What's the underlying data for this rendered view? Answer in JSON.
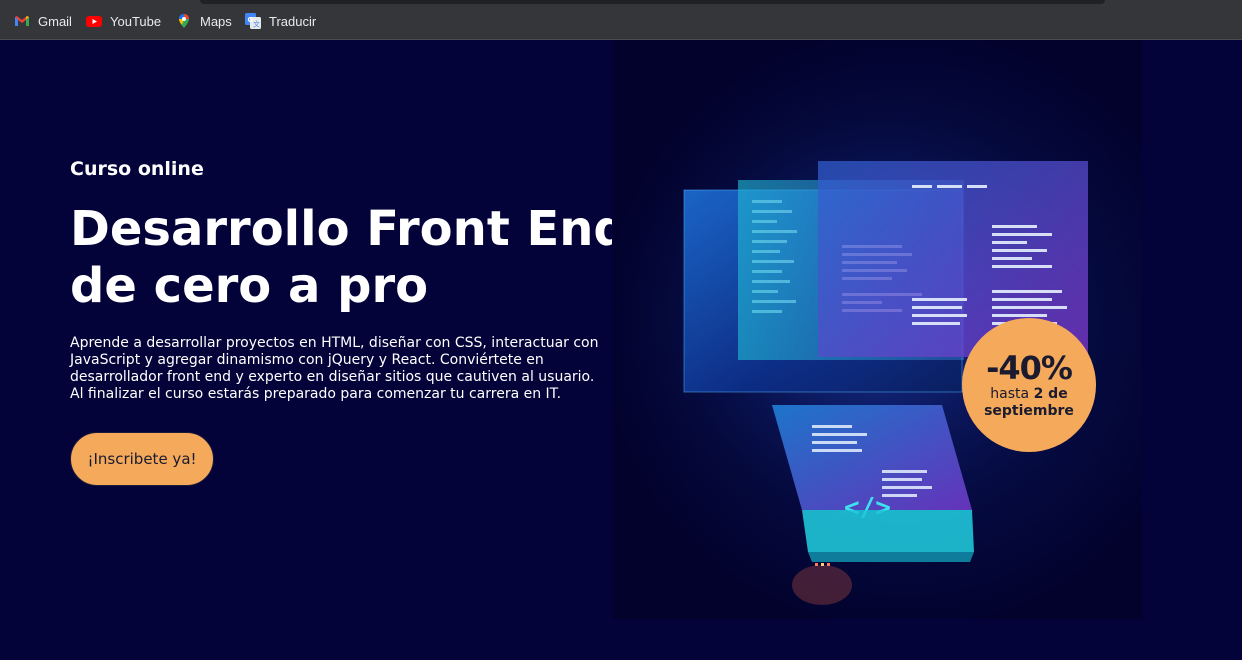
{
  "bookmarks": [
    {
      "label": "Gmail",
      "icon": "gmail-icon"
    },
    {
      "label": "YouTube",
      "icon": "youtube-icon"
    },
    {
      "label": "Maps",
      "icon": "maps-icon"
    },
    {
      "label": "Traducir",
      "icon": "translate-icon"
    }
  ],
  "hero": {
    "eyebrow": "Curso online",
    "title_line1": "Desarrollo Front End",
    "title_line2": "de cero a pro",
    "description": "Aprende a desarrollar proyectos en HTML, diseñar con CSS, interactuar con JavaScript y agregar dinamismo con jQuery y React. Conviértete en desarrollador front end y experto en diseñar sitios que cautiven al usuario. Al finalizar el curso estarás preparado para comenzar tu carrera en IT.",
    "cta_label": "¡Inscribete ya!"
  },
  "badge": {
    "discount": "-40%",
    "until_prefix": "hasta",
    "until_day": "2 de",
    "until_month": "septiembre"
  },
  "colors": {
    "background": "#03033a",
    "accent": "#f5a95b",
    "screen_cyan": "#22d3e0",
    "screen_purple": "#7a3cc8"
  }
}
